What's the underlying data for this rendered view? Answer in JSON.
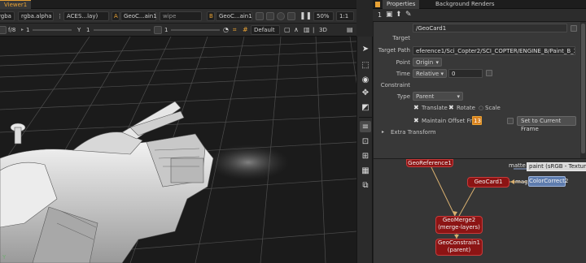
{
  "viewer": {
    "tabs": [
      {
        "label": "Viewer1",
        "active": true
      }
    ],
    "toolbar1": {
      "channels": "rgba",
      "channel_alpha": "rgba.alpha",
      "colorspace": "ACES...lay)",
      "input_a_letter": "A",
      "input_a": "GeoC...ain1",
      "wipe": "wipe",
      "input_b_letter": "B",
      "input_b": "GeoC...ain1",
      "zoom": "50%",
      "ratio": "1:1"
    },
    "toolbar2": {
      "fstop": "f/8",
      "gain": "1",
      "gamma_label": "Y",
      "gamma": "1",
      "frame": "1",
      "view_mode": "Default",
      "dim_mode": "3D"
    },
    "axis_label": "Y"
  },
  "panel": {
    "tabs": [
      {
        "label": "Properties",
        "active": true
      },
      {
        "label": "Background Renders",
        "active": false
      }
    ],
    "toolbar_number": "1"
  },
  "properties": {
    "node_name": "/GeoCard1",
    "target_label": "Target",
    "target_path_label": "Target Path",
    "target_path": "eference1/Sci_Copter2/SCI_COPTER/ENGINE_B/Paint_B_3",
    "point_label": "Point",
    "point_value": "Origin",
    "time_label": "Time",
    "time_value": "Relative",
    "time_offset": "0",
    "constraint_label": "Constraint",
    "type_label": "Type",
    "type_value": "Parent",
    "translate_label": "Translate",
    "rotate_label": "Rotate",
    "scale_label": "Scale",
    "maintain_offset_label": "Maintain Offset Fra",
    "maintain_offset_value": "13",
    "set_current_frame_button": "Set to Current Frame",
    "extra_transform_label": "Extra Transform"
  },
  "node_graph": {
    "matte_text": "matte",
    "paint_text": "paint (sRGB - Texture",
    "mag_text": "mag",
    "nodes": {
      "geo_reference": "GeoReference1",
      "geo_card": "GeoCard1",
      "color_correct": "ColorCorrect2",
      "geo_merge_line1": "GeoMerge2",
      "geo_merge_line2": "(merge-layers)",
      "geo_constrain_line1": "GeoConstrain1",
      "geo_constrain_line2": "(parent)"
    }
  },
  "colors": {
    "accent": "#e8a235",
    "node_red": "#8c1414",
    "node_blue": "#5e7cae",
    "panel_bg": "#383838",
    "viewport_bg": "#1b1b1b"
  }
}
